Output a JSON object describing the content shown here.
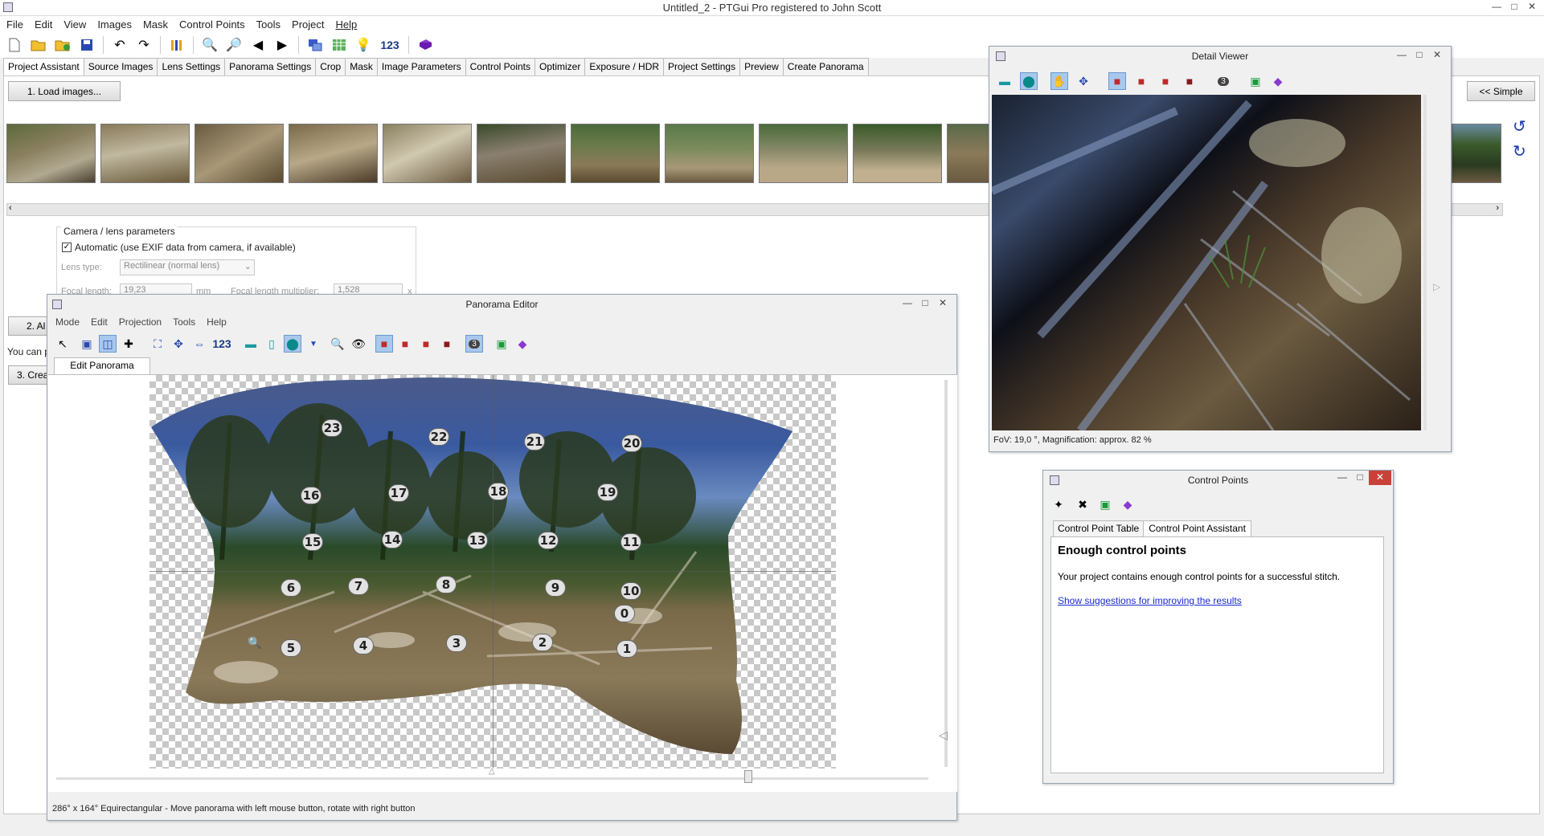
{
  "app": {
    "title": "Untitled_2 - PTGui Pro registered to John Scott",
    "menu": [
      "File",
      "Edit",
      "View",
      "Images",
      "Mask",
      "Control Points",
      "Tools",
      "Project",
      "Help"
    ],
    "toolbar_number": "123"
  },
  "tabs": [
    "Project Assistant",
    "Source Images",
    "Lens Settings",
    "Panorama Settings",
    "Crop",
    "Mask",
    "Image Parameters",
    "Control Points",
    "Optimizer",
    "Exposure / HDR",
    "Project Settings",
    "Preview",
    "Create Panorama"
  ],
  "assistant": {
    "load_images": "1. Load images...",
    "simple_button": "<< Simple",
    "step2": "2. Al",
    "step2_text": "You can p",
    "step3": "3. Crea",
    "camera": {
      "group_title": "Camera / lens parameters",
      "automatic_label": "Automatic (use EXIF data from camera, if available)",
      "automatic_checked": true,
      "lens_type_label": "Lens type:",
      "lens_type_value": "Rectilinear (normal lens)",
      "focal_length_label": "Focal length:",
      "focal_length_value": "19,23",
      "focal_unit": "mm",
      "multiplier_label": "Focal length multiplier:",
      "multiplier_value": "1,528",
      "multiplier_suffix": "x"
    }
  },
  "panorama_editor": {
    "title": "Panorama Editor",
    "menu": [
      "Mode",
      "Edit",
      "Projection",
      "Tools",
      "Help"
    ],
    "toolbar_number": "123",
    "badge": "3",
    "tab": "Edit Panorama",
    "status": "286° x 164° Equirectangular - Move panorama with left mouse button, rotate with right button",
    "points": [
      "23",
      "22",
      "21",
      "20",
      "16",
      "17",
      "18",
      "19",
      "15",
      "14",
      "13",
      "12",
      "11",
      "6",
      "7",
      "8",
      "9",
      "10",
      "0",
      "5",
      "4",
      "3",
      "2",
      "1"
    ]
  },
  "detail_viewer": {
    "title": "Detail Viewer",
    "badge": "3",
    "status": "FoV: 19,0 °, Magnification: approx. 82 %"
  },
  "control_points": {
    "title": "Control Points",
    "tabs": [
      "Control Point Table",
      "Control Point Assistant"
    ],
    "heading": "Enough control points",
    "text": "Your project contains enough control points for a successful stitch.",
    "link": "Show suggestions for improving the results"
  },
  "colors": {
    "accent": "#a8c8ec",
    "close": "#c8423a",
    "link": "#1a2ad0"
  }
}
